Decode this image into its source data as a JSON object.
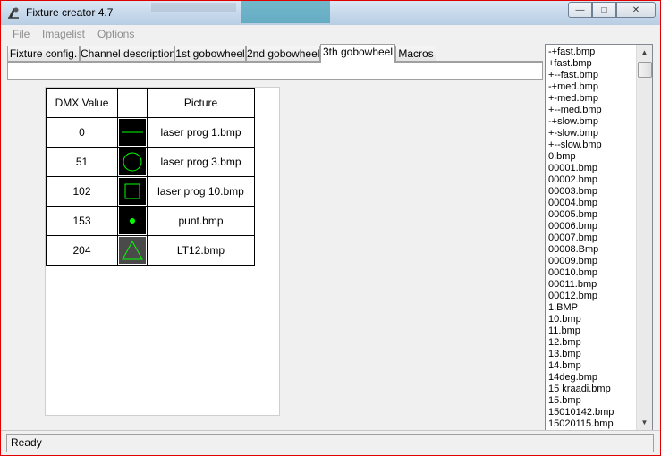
{
  "window": {
    "title": "Fixture creator 4.7"
  },
  "menu": [
    "File",
    "Imagelist",
    "Options"
  ],
  "tabs": [
    "Fixture config.",
    "Channel description",
    "1st gobowheel",
    "2nd gobowheel",
    "3th gobowheel",
    "Macros"
  ],
  "active_tab": "3th gobowheel",
  "table": {
    "headers": [
      "DMX Value",
      "",
      "Picture"
    ],
    "rows": [
      {
        "dmx": "0",
        "picture": "laser prog 1.bmp",
        "icon": "line-icon"
      },
      {
        "dmx": "51",
        "picture": "laser prog 3.bmp",
        "icon": "circle-icon"
      },
      {
        "dmx": "102",
        "picture": "laser prog 10.bmp",
        "icon": "square-icon"
      },
      {
        "dmx": "153",
        "picture": "punt.bmp",
        "icon": "dot-icon"
      },
      {
        "dmx": "204",
        "picture": "LT12.bmp",
        "icon": "triangle-icon"
      }
    ]
  },
  "file_list": [
    "-+fast.bmp",
    "+fast.bmp",
    "+--fast.bmp",
    "-+med.bmp",
    "+-med.bmp",
    "+--med.bmp",
    "-+slow.bmp",
    "+-slow.bmp",
    "+--slow.bmp",
    "0.bmp",
    "00001.bmp",
    "00002.bmp",
    "00003.bmp",
    "00004.bmp",
    "00005.bmp",
    "00006.bmp",
    "00007.bmp",
    "00008.Bmp",
    "00009.bmp",
    "00010.bmp",
    "00011.bmp",
    "00012.bmp",
    "1.BMP",
    "10.bmp",
    "11.bmp",
    "12.bmp",
    "13.bmp",
    "14.bmp",
    "14deg.bmp",
    "15 kraadi.bmp",
    "15.bmp",
    "15010142.bmp",
    "15020115.bmp"
  ],
  "status": "Ready",
  "colors": {
    "gobo_stroke": "#00ff00",
    "frame_border": "#e00000"
  }
}
